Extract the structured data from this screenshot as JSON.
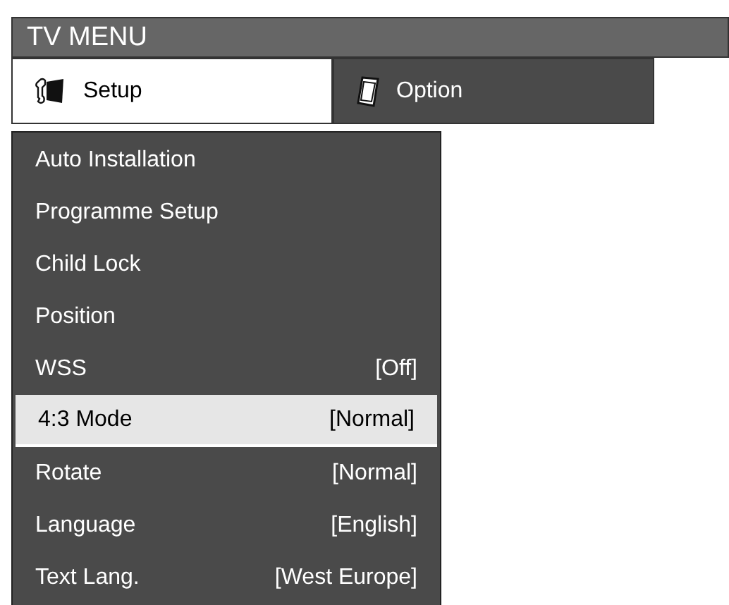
{
  "window": {
    "title": "TV MENU"
  },
  "tabs": [
    {
      "label": "Setup",
      "selected": true,
      "kind": "setup"
    },
    {
      "label": "Option",
      "selected": false,
      "kind": "option"
    }
  ],
  "menu": {
    "items": [
      {
        "label": "Auto Installation",
        "selected": false
      },
      {
        "label": "Programme Setup",
        "selected": false
      },
      {
        "label": "Child Lock",
        "selected": false
      },
      {
        "label": "Position",
        "selected": false
      },
      {
        "label": "WSS",
        "value": "[Off]",
        "selected": false
      },
      {
        "label": "4:3 Mode",
        "value": "[Normal]",
        "selected": true
      },
      {
        "label": "Rotate",
        "value": "[Normal]",
        "selected": false
      },
      {
        "label": "Language",
        "value": "[English]",
        "selected": false
      },
      {
        "label": "Text Lang.",
        "value": "[West Europe]",
        "selected": false
      }
    ]
  }
}
